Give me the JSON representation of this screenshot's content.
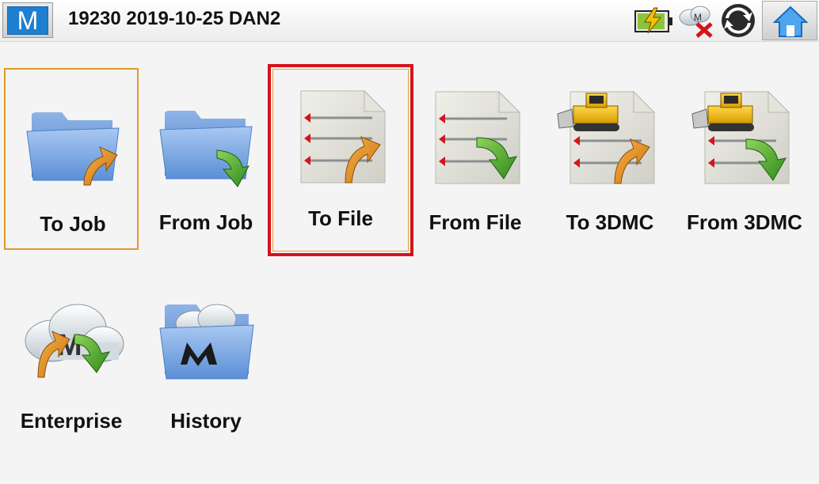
{
  "header": {
    "title": "19230 2019-10-25 DAN2",
    "app_logo_letter": "M",
    "icons": [
      "battery-charging-icon",
      "cloud-disconnected-icon",
      "sync-icon",
      "home-icon"
    ]
  },
  "tiles": [
    {
      "label": "To Job",
      "icon": "folder-upload-icon",
      "state": "selected"
    },
    {
      "label": "From Job",
      "icon": "folder-download-icon",
      "state": "normal"
    },
    {
      "label": "To File",
      "icon": "file-upload-icon",
      "state": "focused"
    },
    {
      "label": "From File",
      "icon": "file-download-icon",
      "state": "normal"
    },
    {
      "label": "To 3DMC",
      "icon": "machine-control-upload-icon",
      "state": "normal"
    },
    {
      "label": "From 3DMC",
      "icon": "machine-control-download-icon",
      "state": "normal"
    },
    {
      "label": "Enterprise",
      "icon": "cloud-sync-icon",
      "state": "normal"
    },
    {
      "label": "History",
      "icon": "folder-history-icon",
      "state": "normal"
    }
  ],
  "colors": {
    "selected_border": "#e09a2a",
    "focused_border": "#d4141c",
    "folder_blue": "#6fa2e0",
    "arrow_orange": "#e8941a",
    "arrow_green": "#45a82a"
  }
}
